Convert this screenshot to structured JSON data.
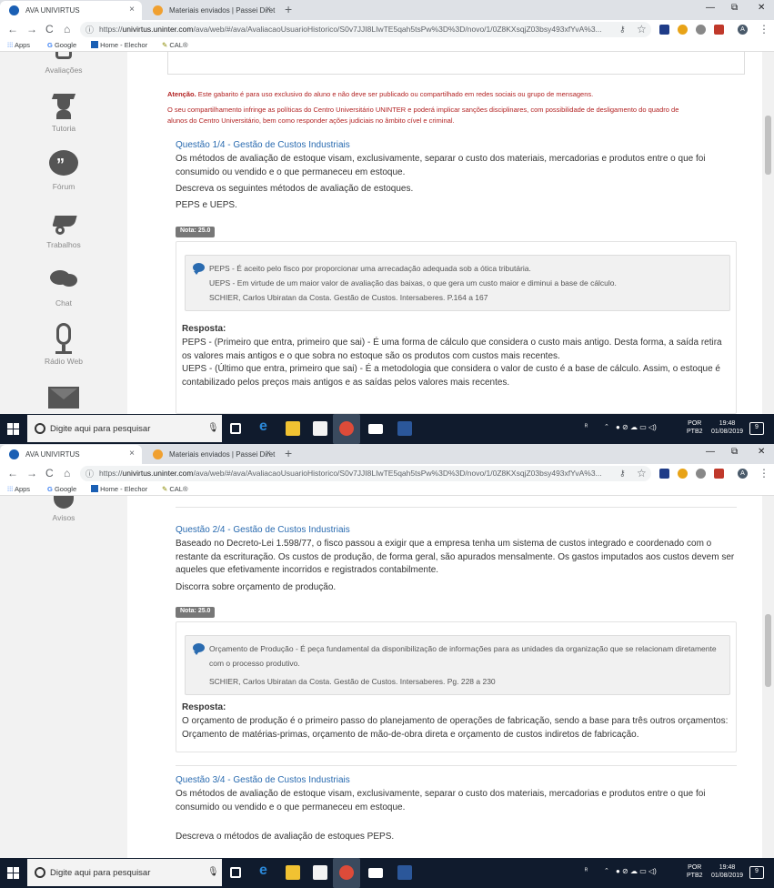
{
  "browser": {
    "tabs": [
      {
        "title": "AVA UNIVIRTUS",
        "close": "×"
      },
      {
        "title": "Materiais enviados | Passei Diret",
        "close": "×"
      }
    ],
    "new_tab": "+",
    "window_controls": [
      "—",
      "⧉",
      "✕"
    ],
    "nav": {
      "back": "←",
      "forward": "→",
      "reload": "C",
      "home": "⌂"
    },
    "url_host": "univirtus.uninter.com",
    "url_scheme": "https://",
    "url_path": "/ava/web/#/ava/AvaliacaoUsuarioHistorico/S0v7JJI8LIwTE5qah5tsPw%3D%3D/novo/1/0Z8KXsqjZ03bsy493xfYvA%3...",
    "profile_initial": "A",
    "bookmarks": [
      "Apps",
      "Google",
      "Home - Elechor",
      "CAL®"
    ]
  },
  "sidebar": {
    "pane1": [
      "Avaliações",
      "Tutoria",
      "Fórum",
      "Trabalhos",
      "Chat",
      "Rádio Web"
    ],
    "pane2": [
      "Avisos"
    ]
  },
  "warning": {
    "label": "Atenção.",
    "line1": "Este gabarito é para uso exclusivo do aluno e não deve ser publicado ou compartilhado em redes sociais ou grupo de mensagens.",
    "line2": "O seu compartilhamento infringe as políticas do Centro Universitário UNINTER e poderá implicar sanções disciplinares, com possibilidade de desligamento do quadro de",
    "line3": "alunos do Centro Universitário, bem como responder ações judiciais no âmbito cível e criminal."
  },
  "q1": {
    "title": "Questão 1/4 - Gestão de Custos Industriais",
    "text1": "Os métodos de avaliação de estoque visam, exclusivamente, separar o custo dos materiais, mercadorias e produtos entre o que foi consumido ou vendido e o que permaneceu em estoque.",
    "text2": "Descreva os seguintes métodos de avaliação de estoques.",
    "text3": "PEPS e UEPS.",
    "nota": "Nota: 25.0",
    "note1": "PEPS - É aceito pelo fisco por proporcionar uma arrecadação adequada sob a ótica tributária.",
    "note2": "UEPS - Em virtude de um maior valor de avaliação das baixas, o que gera um custo maior e diminui a base de cálculo.",
    "note3": "SCHIER, Carlos Ubiratan da Costa. Gestão de Custos. Intersaberes. P.164 a 167",
    "resposta_label": "Resposta:",
    "resposta1": "PEPS - (Primeiro que entra, primeiro que sai) - É uma forma de cálculo que considera o custo mais antigo. Desta forma, a saída retira os valores mais antigos e o que sobra no estoque são os produtos com custos mais recentes.",
    "resposta2": "UEPS - (Último que entra, primeiro que sai) - É a metodologia que considera o valor de custo é a base de cálculo. Assim, o estoque é contabilizado pelos preços mais antigos e as saídas pelos valores mais recentes."
  },
  "q2": {
    "title": "Questão 2/4 - Gestão de Custos Industriais",
    "text1": "Baseado no Decreto-Lei 1.598/77, o fisco passou a exigir que a empresa tenha um sistema de custos integrado e coordenado com o restante da escrituração. Os custos de produção, de forma geral, são apurados mensalmente. Os gastos imputados aos custos devem ser aqueles que efetivamente incorridos e registrados contabilmente.",
    "text2": "Discorra sobre orçamento de produção.",
    "nota": "Nota: 25.0",
    "note1": "Orçamento de Produção - É peça fundamental da disponibilização de informações para as unidades da organização que se relacionam diretamente com o processo produtivo.",
    "note2": "SCHIER, Carlos Ubiratan da Costa. Gestão de Custos. Intersaberes. Pg. 228 a 230",
    "resposta_label": "Resposta:",
    "resposta1": "O orçamento de produção é o primeiro passo do planejamento de operações de fabricação, sendo a base para  três outros orçamentos: Orçamento de matérias-primas, orçamento de mão-de-obra direta e orçamento de custos indiretos de fabricação."
  },
  "q3": {
    "title": "Questão 3/4 - Gestão de Custos Industriais",
    "text1": "Os métodos de avaliação de estoque visam, exclusivamente, separar o custo dos materiais, mercadorias e produtos entre o que foi consumido ou vendido e o que permaneceu em estoque.",
    "text2": "Descreva o métodos de avaliação de estoques PEPS."
  },
  "taskbar": {
    "search_placeholder": "Digite aqui para pesquisar",
    "lang1": "POR",
    "lang2": "PTB2",
    "time": "19:48",
    "date": "01/08/2019",
    "notif": "9"
  },
  "colors": {
    "link_blue": "#2a6bb0",
    "warning_red": "#b22222",
    "taskbar": "#101b2d",
    "sidebar": "#f2f2f2"
  },
  "icons": [
    "search-icon",
    "gear-icon"
  ]
}
